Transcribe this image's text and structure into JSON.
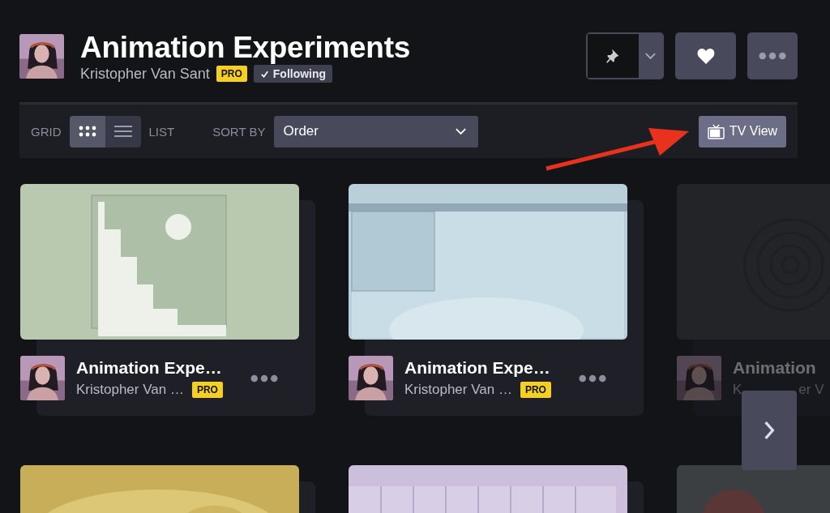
{
  "collection": {
    "title": "Animation Experiments",
    "author": "Kristopher Van Sant",
    "badge": "PRO",
    "follow_button": {
      "label": "Following",
      "selected": true
    }
  },
  "toolbar": {
    "view_modes": [
      {
        "label": "GRID",
        "kind": "grid",
        "selected": true
      },
      {
        "label": "LIST",
        "kind": "list",
        "selected": false
      }
    ],
    "sort_label": "SORT BY",
    "sort_value": "Order",
    "tv_button": "TV View"
  },
  "cards": [
    {
      "title": "Animation Expe…",
      "author": "Kristopher Van …",
      "badge": "PRO",
      "faded": false
    },
    {
      "title": "Animation Expe…",
      "author": "Kristopher Van …",
      "badge": "PRO",
      "faded": false
    },
    {
      "title": "Animation",
      "author": "K",
      "author_after_button": "er V",
      "faded": true
    }
  ]
}
